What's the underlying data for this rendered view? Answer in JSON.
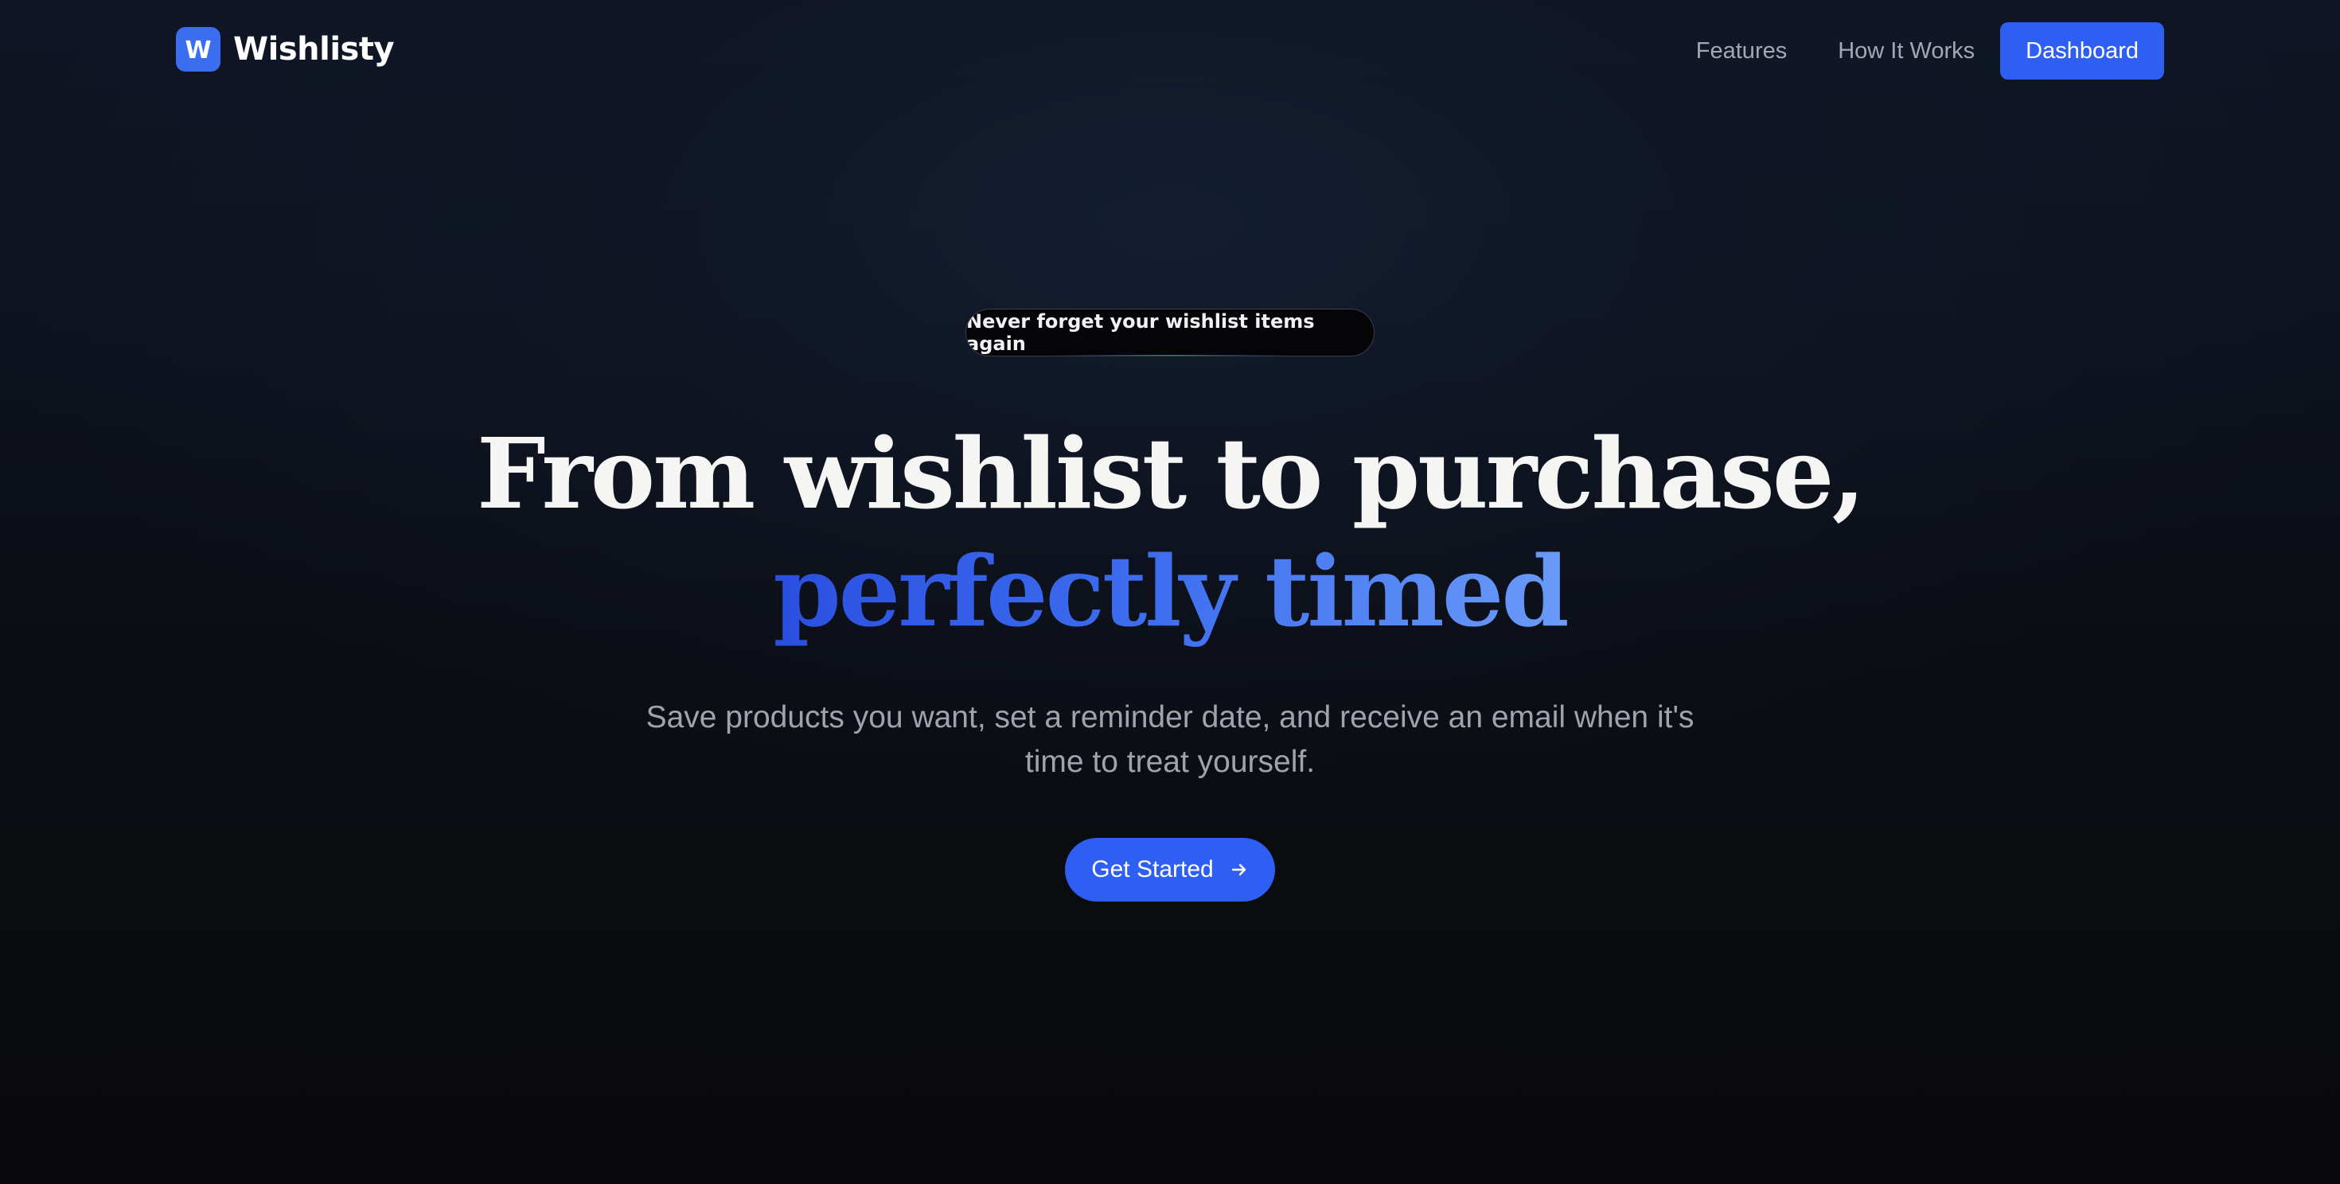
{
  "brand": {
    "logo_letter": "W",
    "name": "Wishlisty",
    "logo_color": "#3b6df0"
  },
  "nav": {
    "links": [
      {
        "label": "Features"
      },
      {
        "label": "How It Works"
      }
    ],
    "cta_label": "Dashboard"
  },
  "hero": {
    "badge": "Never forget your wishlist items again",
    "headline_line1": "From wishlist to purchase,",
    "headline_line2": "perfectly timed",
    "subtitle": "Save products you want, set a reminder date, and receive an email when it's time to treat yourself.",
    "cta_label": "Get Started",
    "cta_icon": "arrow-right-icon"
  },
  "colors": {
    "accent": "#2f5ef2",
    "background": "#0b0b0d",
    "headline_gradient": [
      "#2a4fe0",
      "#6a9bf8"
    ]
  }
}
